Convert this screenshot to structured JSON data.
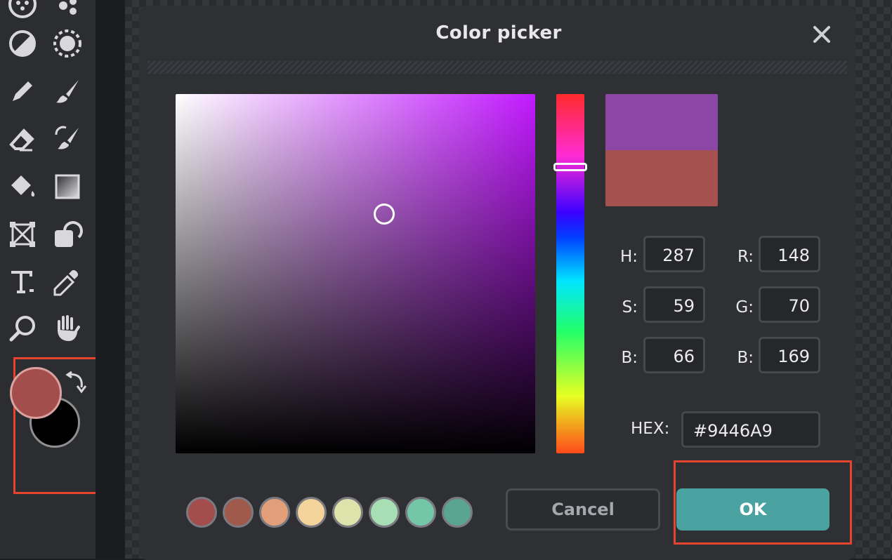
{
  "toolbar": {
    "tools": [
      {
        "name": "filter-icon"
      },
      {
        "name": "effects-icon"
      },
      {
        "name": "adjust-contrast-icon"
      },
      {
        "name": "sun-icon"
      },
      {
        "name": "pencil-icon"
      },
      {
        "name": "brush-icon"
      },
      {
        "name": "eraser-icon"
      },
      {
        "name": "smudge-brush-icon"
      },
      {
        "name": "paint-bucket-icon"
      },
      {
        "name": "gradient-icon"
      },
      {
        "name": "crop-transform-icon"
      },
      {
        "name": "lasso-icon"
      },
      {
        "name": "text-tool-icon"
      },
      {
        "name": "eyedropper-icon"
      },
      {
        "name": "zoom-icon"
      },
      {
        "name": "hand-icon"
      }
    ],
    "foreground_color": "#A44D4D",
    "background_color": "#000000"
  },
  "dialog": {
    "title": "Color picker",
    "close_icon": "close-icon",
    "new_color": "#8B46A6",
    "old_color": "#A55150",
    "fields": {
      "h_label": "H:",
      "h_value": "287",
      "s_label": "S:",
      "s_value": "59",
      "b_label": "B:",
      "b_value": "66",
      "r_label": "R:",
      "r_value": "148",
      "g_label": "G:",
      "g_value": "70",
      "blue_label": "B:",
      "blue_value": "169"
    },
    "hex_label": "HEX:",
    "hex_value": "#9446A9",
    "palette": [
      "#A44D4D",
      "#A05A4C",
      "#E39F79",
      "#F5D49C",
      "#DDE3AA",
      "#A8DEB3",
      "#74C6A8",
      "#5AA591"
    ],
    "cancel_label": "Cancel",
    "ok_label": "OK"
  }
}
